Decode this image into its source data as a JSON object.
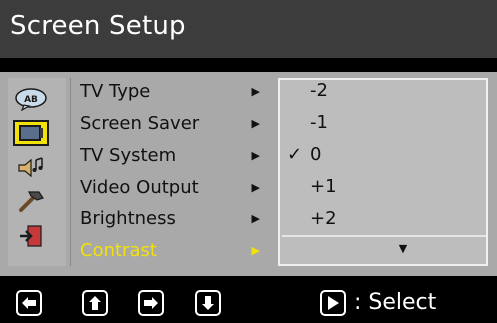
{
  "title": "Screen Setup",
  "icons": [
    {
      "name": "speech-bubble-icon",
      "label": "AB"
    },
    {
      "name": "monitor-icon"
    },
    {
      "name": "speaker-music-icon"
    },
    {
      "name": "hammer-icon"
    },
    {
      "name": "exit-door-icon"
    }
  ],
  "menu": [
    {
      "label": "TV Type"
    },
    {
      "label": "Screen Saver"
    },
    {
      "label": "TV System"
    },
    {
      "label": "Video Output"
    },
    {
      "label": "Brightness"
    },
    {
      "label": "Contrast"
    }
  ],
  "values": [
    {
      "label": "-2"
    },
    {
      "label": "-1"
    },
    {
      "label": "0",
      "checked": true
    },
    {
      "label": "+1"
    },
    {
      "label": "+2"
    }
  ],
  "check_mark": "✓",
  "footer": {
    "select_label": ": Select"
  },
  "colors": {
    "highlight": "#f2e20a",
    "title_bg": "#3c3c3c",
    "panel_bg": "#a9a9a9"
  }
}
